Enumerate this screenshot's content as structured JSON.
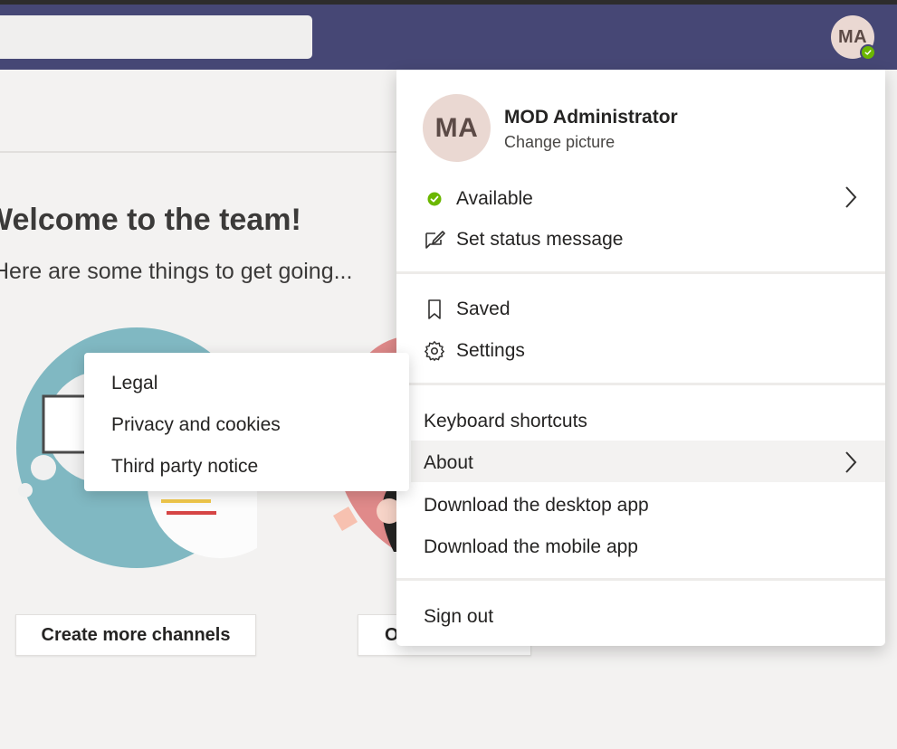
{
  "header": {
    "avatar_initials": "MA",
    "presence_color": "#6bb700",
    "search_placeholder": ""
  },
  "main": {
    "welcome_title": "Welcome to the team!",
    "welcome_subtitle": "Here are some things to get going...",
    "buttons": {
      "create_channels": "Create more channels",
      "second_visible": "O"
    }
  },
  "about_submenu": {
    "items": [
      "Legal",
      "Privacy and cookies",
      "Third party notice"
    ]
  },
  "profile_menu": {
    "avatar_initials": "MA",
    "user_name": "MOD Administrator",
    "change_picture": "Change picture",
    "status": "Available",
    "set_status": "Set status message",
    "saved": "Saved",
    "settings": "Settings",
    "keyboard_shortcuts": "Keyboard shortcuts",
    "about": "About",
    "download_desktop": "Download the desktop app",
    "download_mobile": "Download the mobile app",
    "sign_out": "Sign out"
  },
  "icons": {
    "presence": "check-circle-icon",
    "status_message": "pencil-note-icon",
    "saved": "bookmark-icon",
    "settings": "gear-icon",
    "chevron": "chevron-right-icon"
  },
  "colors": {
    "top_bar": "#464775",
    "available": "#6bb700",
    "avatar_bg": "#ead8d2",
    "page_bg": "#f3f2f1"
  }
}
